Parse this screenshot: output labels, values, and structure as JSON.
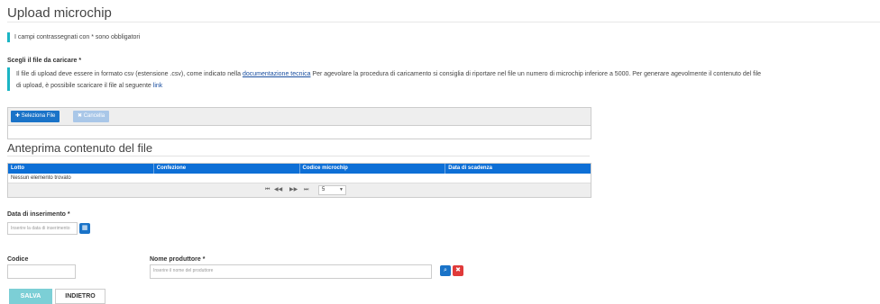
{
  "page": {
    "title": "Upload microchip",
    "required_note": "I campi contrassegnati con * sono obbligatori"
  },
  "upload": {
    "label": "Scegli il file da caricare *",
    "info_part1": "Il file di upload deve essere in formato csv (estensione .csv), come indicato nella ",
    "info_link1": "documentazione tecnica",
    "info_part2": " Per agevolare la procedura di caricamento si consiglia di riportare nel file un numero di microchip inferiore a 5000. Per generare agevolmente il contenuto del file",
    "info_line2": "di upload, è possibile scaricare il file al seguente ",
    "info_link2": "link",
    "select_button": "Seleziona File",
    "cancel_button": "Cancella"
  },
  "preview": {
    "title": "Anteprima contenuto del file",
    "columns": [
      "Lotto",
      "Confezione",
      "Codice microchip",
      "Data di scadenza"
    ],
    "empty_text": "Nessun elemento trovato",
    "pager": {
      "first": "⏮",
      "prev": "◀◀",
      "next": "▶▶",
      "last": "⏭",
      "page_size": "5"
    }
  },
  "form": {
    "data_label": "Data di inserimento *",
    "data_placeholder": "Inserire la data di inserimento",
    "codice_label": "Codice",
    "codice_value": "",
    "produttore_label": "Nome produttore *",
    "produttore_placeholder": "Inserire il nome del produttore"
  },
  "actions": {
    "save": "SALVA",
    "back": "INDIETRO"
  },
  "colors": {
    "accent": "#1bb5c4",
    "primary": "#1a73c8",
    "table_header": "#0d6fd6",
    "danger": "#e03a3a",
    "save_button": "#7ccfd6"
  }
}
